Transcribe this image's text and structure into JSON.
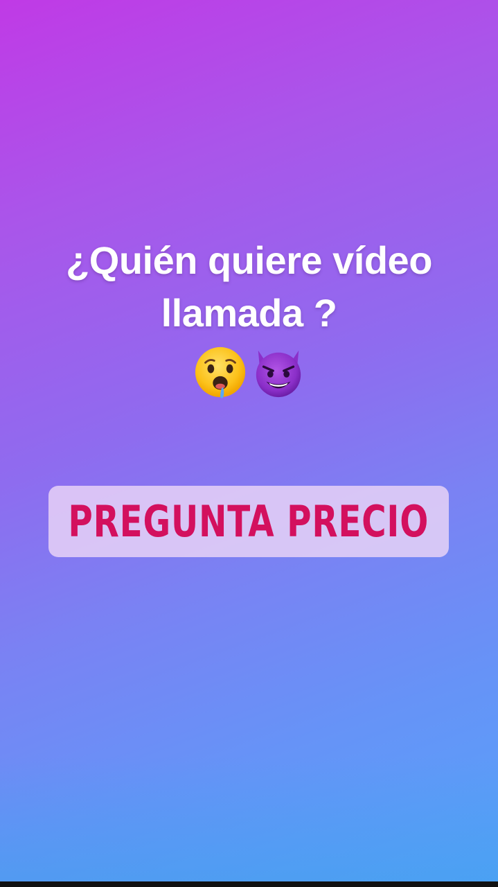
{
  "story": {
    "headline_line1": "¿Quién quiere vídeo",
    "headline_line2": "llamada ?",
    "emojis": [
      "drooling-face-icon",
      "smiling-face-with-horns-icon"
    ],
    "sticker_label": "PREGUNTA PRECIO"
  },
  "colors": {
    "gradient_top": "#c03ae6",
    "gradient_bottom": "#56a2f9",
    "headline_text": "#ffffff",
    "sticker_text": "#d3105e",
    "sticker_bg": "#ecd6f6"
  }
}
